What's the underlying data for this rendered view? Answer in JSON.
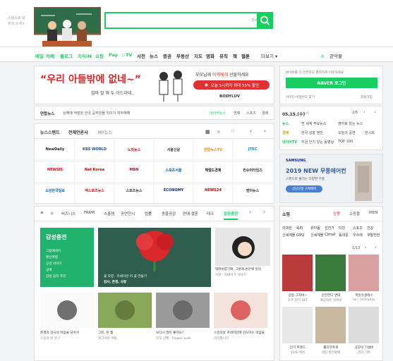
{
  "header": {
    "logo_lines": [
      "스윙스로 넣",
      "뒤의 소개↑"
    ],
    "search_placeholder": "",
    "search_hint": "한/A"
  },
  "nav": {
    "items": [
      {
        "label": "메일",
        "color": "#19ce60"
      },
      {
        "label": "카페",
        "color": "#19ce60"
      },
      {
        "label": "블로그",
        "color": "#19ce60"
      },
      {
        "label": "지식iN",
        "color": "#19ce60"
      },
      {
        "label": "쇼핑",
        "color": "#19ce60"
      },
      {
        "label": "Pay",
        "color": "#19ce60"
      },
      {
        "label": "▷TV",
        "color": "#19ce60"
      },
      {
        "label": "사전",
        "color": "#333"
      },
      {
        "label": "뉴스",
        "color": "#333"
      },
      {
        "label": "증권",
        "color": "#333"
      },
      {
        "label": "부동산",
        "color": "#333"
      },
      {
        "label": "지도",
        "color": "#333"
      },
      {
        "label": "영화",
        "color": "#333"
      },
      {
        "label": "뮤직",
        "color": "#333"
      },
      {
        "label": "책",
        "color": "#333"
      },
      {
        "label": "웹툰",
        "color": "#333"
      }
    ],
    "more": "더보기",
    "weather": "8",
    "weather_label": "관악불"
  },
  "ad": {
    "headline": "“우리 아들밖에 없네~”",
    "subline": "엄마 잘 해 두 아드라네..",
    "copy1": "부모님께",
    "copy2": "마약베개",
    "copy3": "선물하세요",
    "deal": "오늘 5시까지 최대 55% 할인",
    "brand": "BODYLUV"
  },
  "login": {
    "notice": "네이버를 더 안전하고 편리하게 이용하세요",
    "button": "NAVER 로그인",
    "find": "아이디·비밀번호 찾기",
    "join": "회원가입"
  },
  "newsticker": {
    "label": "연합뉴스",
    "headline": "상해에 적발된 한국 공무원들 뒤이기 피하해해",
    "links": [
      "네이버뉴스",
      "연예",
      "스포츠",
      "경제"
    ]
  },
  "newsstand": {
    "title": "뉴스스탠드",
    "sub_active": "전체언론사",
    "sub_other": "MY뉴스",
    "media": [
      {
        "name": "NewDaily",
        "color": "#222"
      },
      {
        "name": "KBS WORLD",
        "color": "#1c4fa1"
      },
      {
        "name": "노컷뉴스",
        "color": "#e60012"
      },
      {
        "name": "서울신문",
        "color": "#333"
      },
      {
        "name": "연합뉴스TV",
        "color": "#f08300"
      },
      {
        "name": "JTBC",
        "color": "#00a0e9"
      },
      {
        "name": "NEWSIS",
        "color": "#e60012"
      },
      {
        "name": "Net Korea",
        "color": "#c40000"
      },
      {
        "name": "MBN",
        "color": "#e60012"
      },
      {
        "name": "스포츠서울",
        "color": "#0059a6"
      },
      {
        "name": "헤럴드경제",
        "color": "#222"
      },
      {
        "name": "컨슈머타임즈",
        "color": "#333"
      },
      {
        "name": "소년한국일보",
        "color": "#0062b1"
      },
      {
        "name": "엑스포츠뉴스",
        "color": "#e60012"
      },
      {
        "name": "스포츠뉴스",
        "color": "#333"
      },
      {
        "name": "ECONOMY",
        "color": "#0f2f6b"
      },
      {
        "name": "NEWS24",
        "color": "#d40000"
      },
      {
        "name": "엔터뉴스",
        "color": "#333"
      }
    ]
  },
  "date": {
    "label": "05.15.(수)",
    "sub": "뉴스",
    "page": "2/6",
    "rows": [
      {
        "k": "뉴스",
        "t": "전 세계 주요뉴스",
        "t2": "영어로 읽는 뉴스",
        "c": "#19ce60"
      },
      {
        "k": "경제",
        "t": "한국 성장 엔진",
        "t2": "오늘의 공연",
        "t3": "전시회",
        "c": "#e6a100"
      },
      {
        "k": "네이버TV",
        "t": "지금 인기 있는 동영상",
        "t2": "TOP 100",
        "c": "#19ce60"
      }
    ]
  },
  "banner": {
    "brand": "SAMSUNG",
    "title": "2019 NEW 무풍에어컨",
    "desc": "스탠드로 즐기는 다양한 무풍",
    "cta": "상담신청 구매혜택"
  },
  "content": {
    "tabs": [
      "≡",
      "ㅁ",
      "비즈니스",
      "FARM",
      "스쿨잼",
      "공연전시",
      "법률",
      "동물공감",
      "연애·결혼",
      "테크",
      "감성충전"
    ],
    "active_tab": "감성충전",
    "feature": {
      "title": "감성충전",
      "items": [
        "그림에세이",
        "랜선여행",
        "공감 이야기",
        "공예",
        "감성 음악 추천"
      ]
    },
    "main_caption": [
      "꽃 모양 · 카네이션 어 꽃 만들기",
      "감사, 존경, 사랑"
    ],
    "side_caption": [
      "먹어버렸기에, 그렇게 손안에 일의",
      "사연 · 자네야가 이야기"
    ],
    "grid": [
      {
        "cap1": "존경과 감사의 마음을 담아서",
        "cap2": "스승의 날 문구"
      },
      {
        "cap1": "그린, 린 캠",
        "cap2": "성그야운 어둠"
      },
      {
        "cap1": "보다시 많이 좋아요?",
        "cap2": "뮤직 산책 · Flower walk"
      },
      {
        "cap1": "스승의날 카네이션에 감사하는 마음을",
        "cap2": "감사합니다"
      }
    ]
  },
  "shopping": {
    "title": "쇼핑",
    "tabs": [
      "상품",
      "쇼핑몰",
      "MEN"
    ],
    "active_tab": "상품",
    "categories": [
      [
        "의대원",
        "육퍼",
        "유아동",
        "선전가",
        "티빈",
        "스포츠",
        "건강"
      ],
      [
        "신세계몰",
        "G9닷",
        "신세계몰",
        "CJmall",
        "동대문",
        "우수레",
        "쿠팡전한"
      ]
    ],
    "page": "1/13",
    "products": [
      {
        "name": "감동 그지바~",
        "sub": "호주 단가 SET"
      },
      {
        "name": "안전한다 변대",
        "sub": "예상대로 일위로"
      },
      {
        "name": "파일유생레스",
        "sub": "SET 50%SALE"
      },
      {
        "name": "인기 트렌드",
        "sub": "15% 에서"
      },
      {
        "name": "롤다뷰트로",
        "sub": "세팅 할인판매"
      },
      {
        "name": "공장이 기성비",
        "sub": "관리 기트"
      }
    ]
  }
}
